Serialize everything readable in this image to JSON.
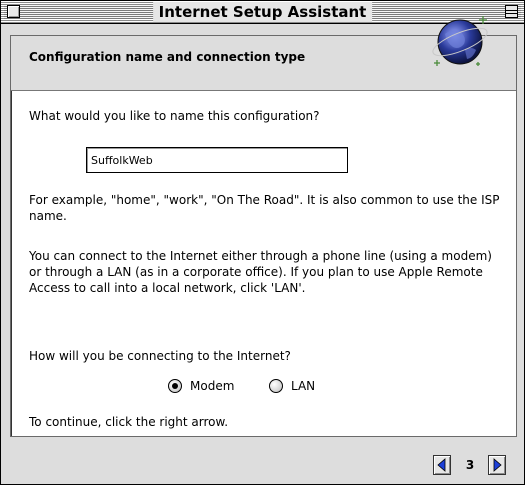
{
  "window": {
    "title": "Internet Setup Assistant"
  },
  "header": {
    "title": "Configuration name and connection type"
  },
  "body": {
    "name_prompt": "What would you like to name this configuration?",
    "name_value": "SuffolkWeb",
    "example_text": "For example, \"home\", \"work\", \"On The Road\".  It is also common to use the ISP name.",
    "connect_text": "You can connect to the Internet either through a phone line (using a modem) or through a LAN (as in a corporate office).  If you plan to use Apple Remote Access to call into a local network, click 'LAN'.",
    "connection_prompt": "How will you be connecting to the Internet?",
    "options": [
      {
        "label": "Modem",
        "selected": true
      },
      {
        "label": "LAN",
        "selected": false
      }
    ],
    "continue_text": "To continue, click the right arrow."
  },
  "nav": {
    "page_number": "3"
  },
  "colors": {
    "arrow": "#1c3fd8",
    "globe": "#2a3a9a"
  },
  "icons": [
    "close-box-icon",
    "zoom-box-icon",
    "globe-icon",
    "left-arrow-icon",
    "right-arrow-icon"
  ]
}
